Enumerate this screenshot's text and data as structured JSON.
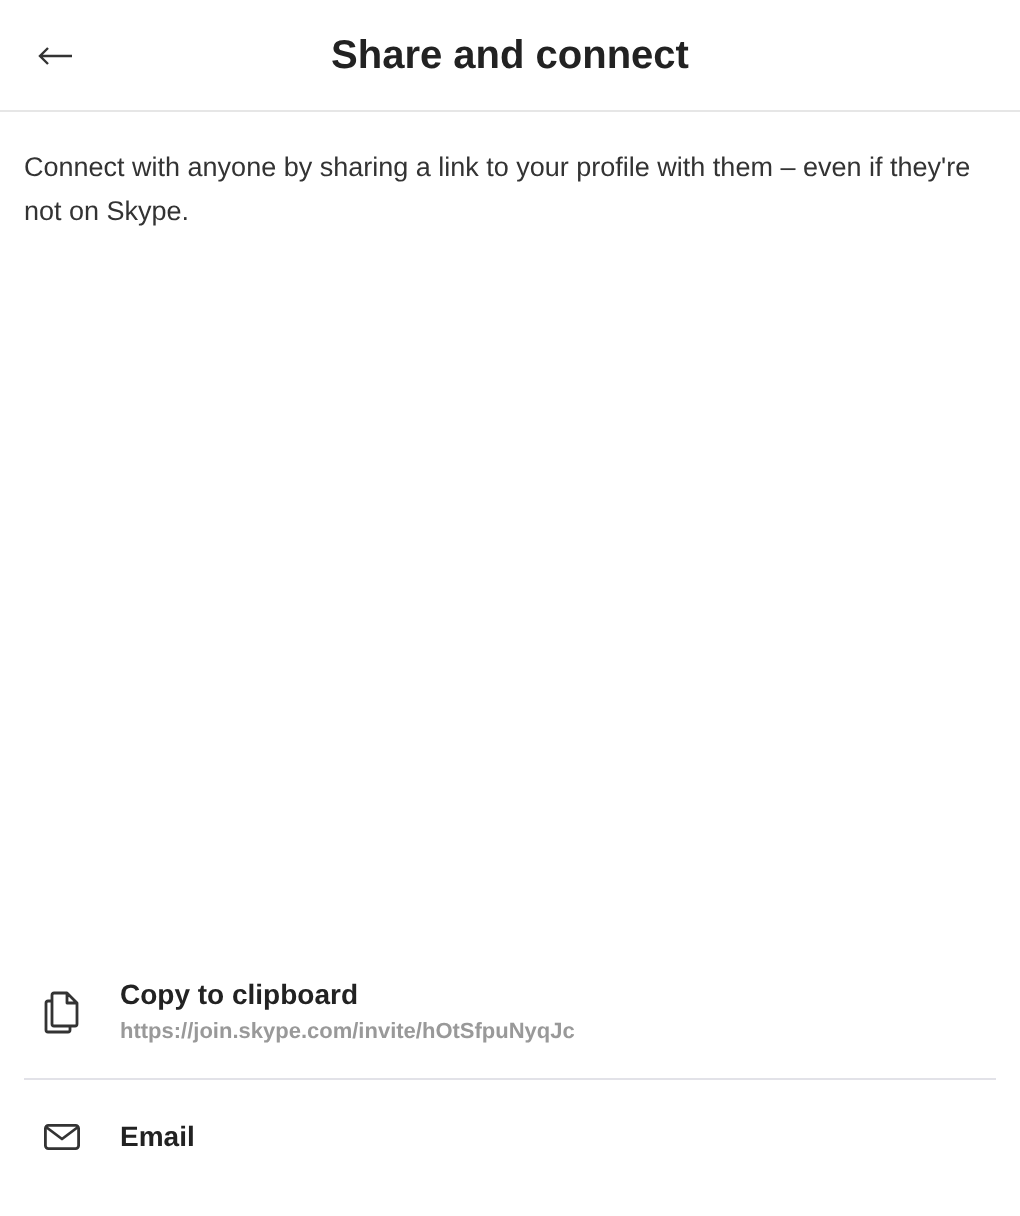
{
  "header": {
    "title": "Share and connect"
  },
  "description": "Connect with anyone by sharing a link to your profile with them – even if they're not on Skype.",
  "options": [
    {
      "kind": "copy",
      "label": "Copy to clipboard",
      "detail": "https://join.skype.com/invite/hOtSfpuNyqJc"
    },
    {
      "kind": "email",
      "label": "Email"
    }
  ]
}
